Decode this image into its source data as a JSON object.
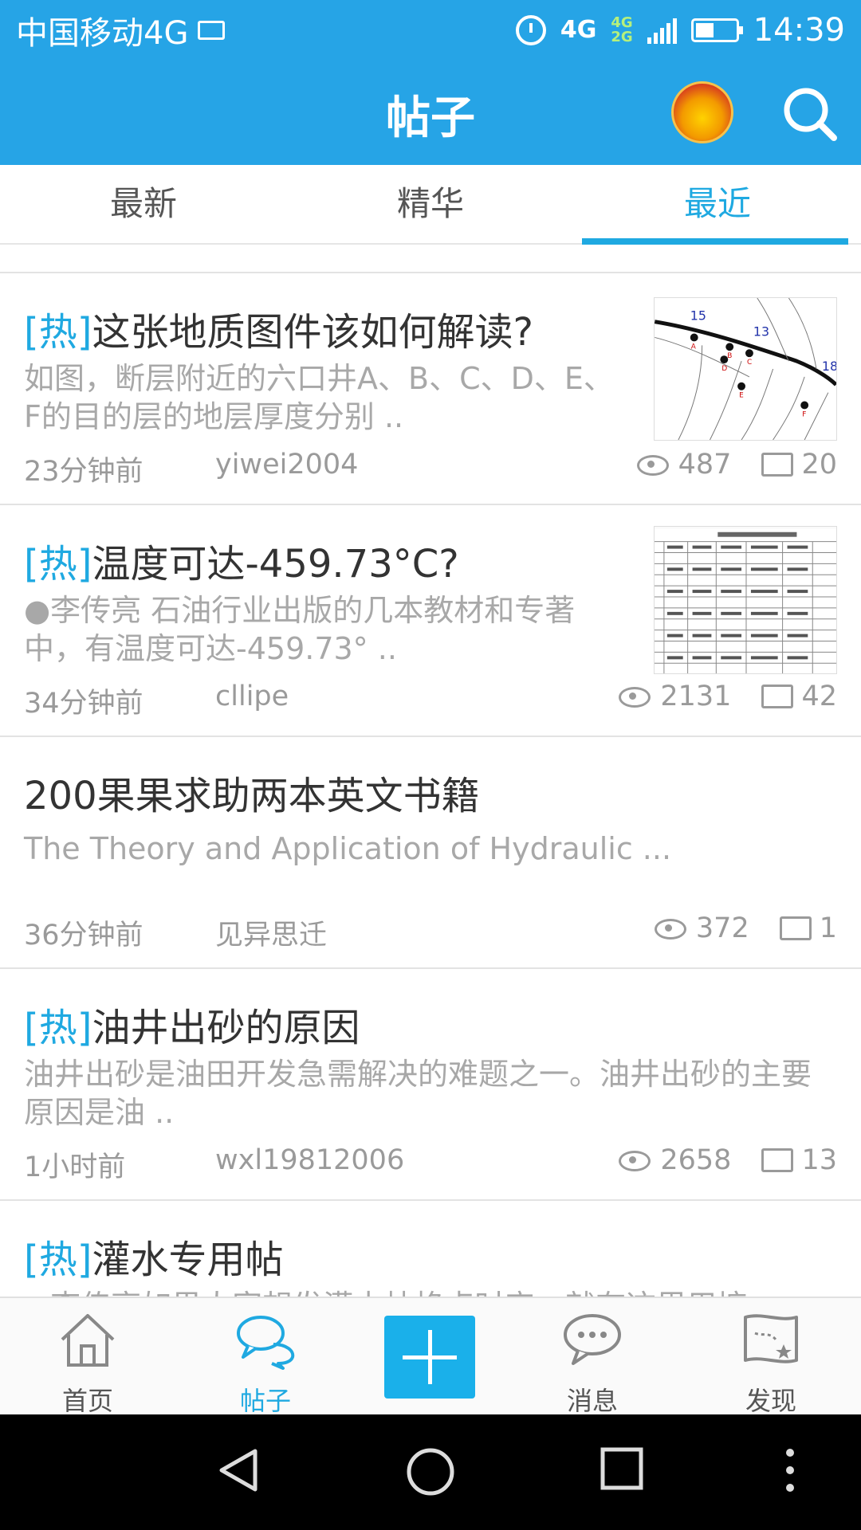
{
  "status_bar": {
    "carrier": "中国移动4G",
    "network_main": "4G",
    "network_sub_top": "4G",
    "network_sub_bottom": "2G",
    "time": "14:39"
  },
  "header": {
    "title": "帖子"
  },
  "tabs": [
    {
      "label": "最新",
      "active": false
    },
    {
      "label": "精华",
      "active": false
    },
    {
      "label": "最近",
      "active": true
    }
  ],
  "posts": [
    {
      "hot": "[热]",
      "title": "这张地质图件该如何解读?",
      "excerpt": "如图，断层附近的六口井A、B、C、D、E、F的目的层的地层厚度分别 ..",
      "time": "23分钟前",
      "author": "yiwei2004",
      "views": "487",
      "comments": "20",
      "thumb_labels": [
        "15",
        "13",
        "18",
        "A",
        "B",
        "C",
        "D",
        "E",
        "F"
      ]
    },
    {
      "hot": "[热]",
      "title": "温度可达-459.73°C?",
      "excerpt": "●李传亮 石油行业出版的几本教材和专著中，有温度可达-459.73° ..",
      "time": "34分钟前",
      "author": "cllipe",
      "views": "2131",
      "comments": "42"
    },
    {
      "hot": "",
      "title": "200果果求助两本英文书籍",
      "excerpt": "The Theory and Application of Hydraulic ...",
      "time": "36分钟前",
      "author": "见异思迁",
      "views": "372",
      "comments": "1"
    },
    {
      "hot": "[热]",
      "title": "油井出砂的原因",
      "excerpt": "油井出砂是油田开发急需解决的难题之一。油井出砂的主要原因是油 ..",
      "time": "1小时前",
      "author": "wxl19812006",
      "views": "2658",
      "comments": "13"
    },
    {
      "hot": "[热]",
      "title": "灌水专用帖",
      "excerpt": "●李传亮如果人家想发灌水帖格点时宜，就有这里用塘",
      "time": "",
      "author": "",
      "views": "",
      "comments": ""
    }
  ],
  "bottom_nav": [
    {
      "label": "首页",
      "icon": "home-icon",
      "active": false
    },
    {
      "label": "帖子",
      "icon": "chat-bubbles-icon",
      "active": true
    },
    {
      "label": "消息",
      "icon": "message-icon",
      "active": false
    },
    {
      "label": "发现",
      "icon": "map-icon",
      "active": false
    }
  ],
  "colors": {
    "header": "#26a4e6",
    "accent": "#1fa9e1",
    "meta_text": "#9a9a9a"
  }
}
